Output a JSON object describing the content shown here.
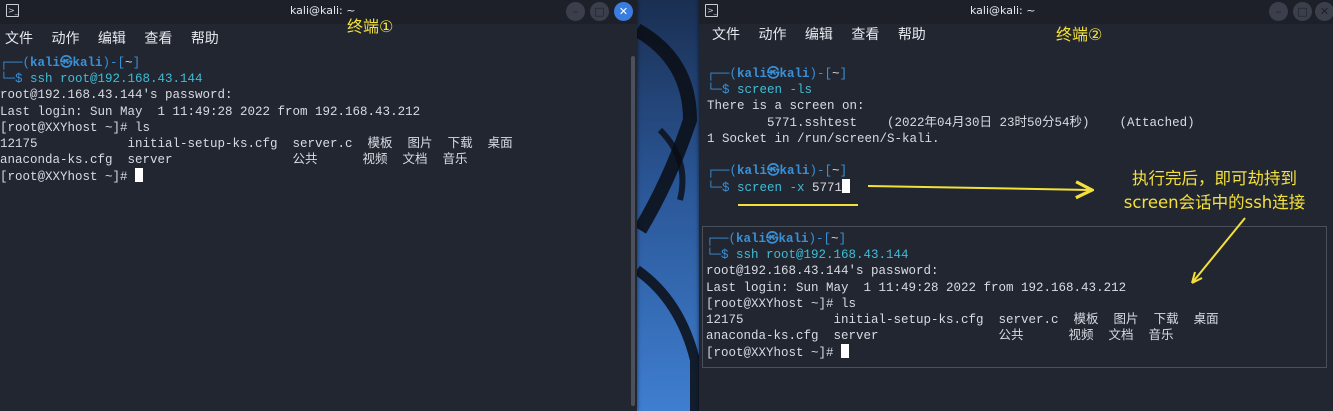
{
  "window1": {
    "title": "kali@kali: ~",
    "label": "终端①",
    "menu": [
      "文件",
      "动作",
      "编辑",
      "查看",
      "帮助"
    ],
    "lines": {
      "prompt_top": "┌──(",
      "user": "kali㉿kali",
      "prompt_mid": ")-[",
      "dir": "~",
      "prompt_end": "]",
      "prompt_bottom": "└─$ ",
      "cmd": "ssh root@192.168.43.144",
      "l1": "root@192.168.43.144's password:",
      "l2": "Last login: Sun May  1 11:49:28 2022 from 192.168.43.212",
      "l3": "[root@XXYhost ~]# ls",
      "l4": "12175            initial-setup-ks.cfg  server.c  模板  图片  下载  桌面",
      "l5": "anaconda-ks.cfg  server                公共      视频  文档  音乐",
      "l6": "[root@XXYhost ~]# "
    }
  },
  "window2": {
    "title": "kali@kali: ~",
    "label": "终端②",
    "menu": [
      "文件",
      "动作",
      "编辑",
      "查看",
      "帮助"
    ],
    "block1": {
      "prompt_top": "┌──(",
      "user": "kali㉿kali",
      "prompt_mid": ")-[",
      "dir": "~",
      "prompt_end": "]",
      "prompt_bottom": "└─$ ",
      "cmd": "screen",
      "flag": " -ls",
      "l1": "There is a screen on:",
      "l2": "        5771.sshtest    (2022年04月30日 23时50分54秒)    (Attached)",
      "l3": "1 Socket in /run/screen/S-kali."
    },
    "block2": {
      "cmd": "screen",
      "flag": " -x",
      "arg": " 5771"
    },
    "inset": {
      "cmd": "ssh root@192.168.43.144",
      "l1": "root@192.168.43.144's password:",
      "l2": "Last login: Sun May  1 11:49:28 2022 from 192.168.43.212",
      "l3": "[root@XXYhost ~]# ls",
      "l4": "12175            initial-setup-ks.cfg  server.c  模板  图片  下载  桌面",
      "l5": "anaconda-ks.cfg  server                公共      视频  文档  音乐",
      "l6": "[root@XXYhost ~]# "
    }
  },
  "annotation": {
    "line1": "执行完后，即可劫持到",
    "line2": "screen会话中的ssh连接"
  },
  "colors": {
    "annotation": "#f3e03a",
    "prompt": "#3a90d6",
    "command": "#3fbdd6",
    "close_button": "#3a7de0"
  },
  "icons": {
    "terminal": "terminal-icon",
    "minimize": "minimize-icon",
    "maximize": "maximize-icon",
    "close": "close-icon"
  }
}
